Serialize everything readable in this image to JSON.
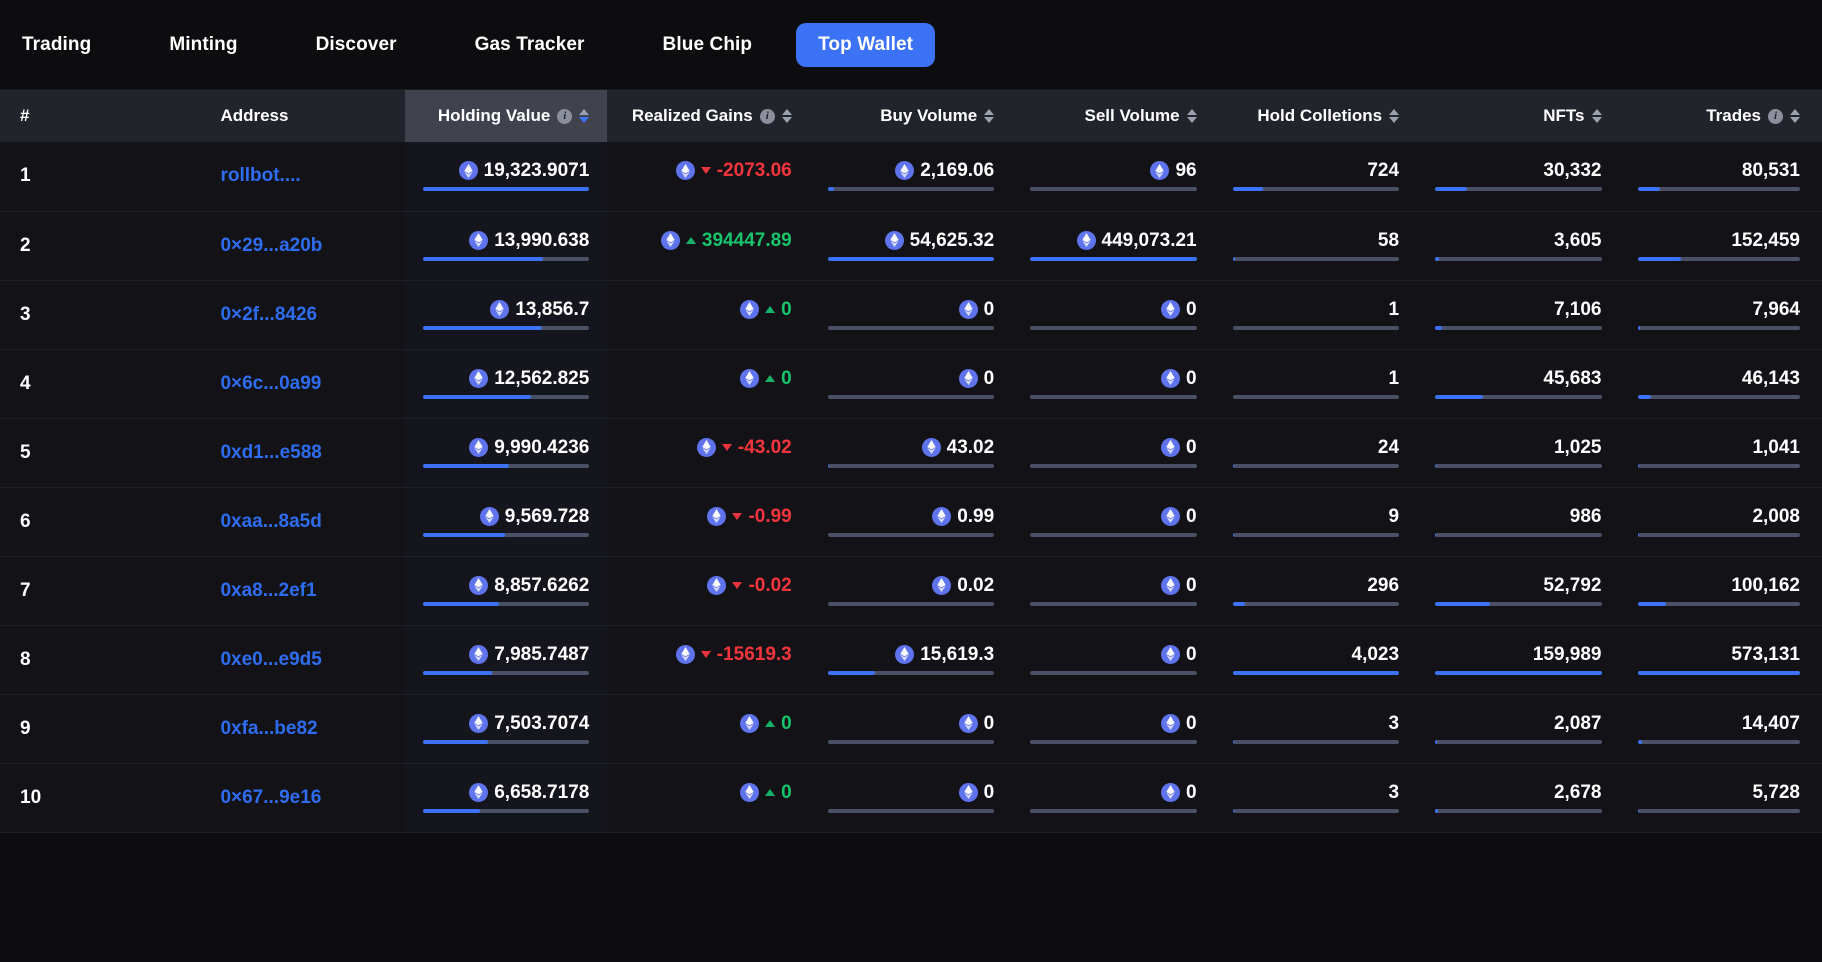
{
  "nav": {
    "items": [
      {
        "label": "Trading",
        "active": false
      },
      {
        "label": "Minting",
        "active": false
      },
      {
        "label": "Discover",
        "active": false
      },
      {
        "label": "Gas Tracker",
        "active": false
      },
      {
        "label": "Blue Chip",
        "active": false
      },
      {
        "label": "Top Wallet",
        "active": true
      }
    ]
  },
  "colors": {
    "accent": "#3b72f6",
    "link": "#2f6df0",
    "positive": "#18c46c",
    "negative": "#f4353d",
    "bar_track": "#4a5166",
    "header_bg": "#22242c",
    "header_active_bg": "#40434e",
    "page_bg": "#0d0d10",
    "table_bg": "#121217"
  },
  "table": {
    "columns": [
      {
        "key": "rank",
        "label": "#",
        "align": "left",
        "info": false,
        "sortable": false,
        "sort": "none",
        "active": false
      },
      {
        "key": "address",
        "label": "Address",
        "align": "left",
        "info": false,
        "sortable": false,
        "sort": "none",
        "active": false
      },
      {
        "key": "holding",
        "label": "Holding Value",
        "align": "right",
        "info": true,
        "sortable": true,
        "sort": "desc",
        "active": true
      },
      {
        "key": "gains",
        "label": "Realized Gains",
        "align": "right",
        "info": true,
        "sortable": true,
        "sort": "none",
        "active": false
      },
      {
        "key": "buy",
        "label": "Buy Volume",
        "align": "right",
        "info": false,
        "sortable": true,
        "sort": "none",
        "active": false
      },
      {
        "key": "sell",
        "label": "Sell Volume",
        "align": "right",
        "info": false,
        "sortable": true,
        "sort": "none",
        "active": false
      },
      {
        "key": "hold",
        "label": "Hold Colletions",
        "align": "right",
        "info": false,
        "sortable": true,
        "sort": "none",
        "active": false
      },
      {
        "key": "nfts",
        "label": "NFTs",
        "align": "right",
        "info": false,
        "sortable": true,
        "sort": "none",
        "active": false
      },
      {
        "key": "trades",
        "label": "Trades",
        "align": "right",
        "info": true,
        "sortable": true,
        "sort": "none",
        "active": false
      }
    ],
    "maxima": {
      "holding": 19323.9071,
      "buy": 54625.32,
      "sell": 449073.21,
      "hold": 4023,
      "nfts": 159989,
      "trades": 573131
    },
    "rows": [
      {
        "rank": "1",
        "address": "rollbot....",
        "holding": {
          "text": "19,323.9071",
          "value": 19323.9071,
          "eth": true
        },
        "gains": {
          "text": "-2073.06",
          "value": -2073.06,
          "eth": true,
          "dir": "down"
        },
        "buy": {
          "text": "2,169.06",
          "value": 2169.06,
          "eth": true
        },
        "sell": {
          "text": "96",
          "value": 96,
          "eth": true
        },
        "hold": {
          "text": "724",
          "value": 724,
          "eth": false
        },
        "nfts": {
          "text": "30,332",
          "value": 30332,
          "eth": false
        },
        "trades": {
          "text": "80,531",
          "value": 80531,
          "eth": false
        }
      },
      {
        "rank": "2",
        "address": "0×29...a20b",
        "holding": {
          "text": "13,990.638",
          "value": 13990.638,
          "eth": true
        },
        "gains": {
          "text": "394447.89",
          "value": 394447.89,
          "eth": true,
          "dir": "up"
        },
        "buy": {
          "text": "54,625.32",
          "value": 54625.32,
          "eth": true
        },
        "sell": {
          "text": "449,073.21",
          "value": 449073.21,
          "eth": true
        },
        "hold": {
          "text": "58",
          "value": 58,
          "eth": false
        },
        "nfts": {
          "text": "3,605",
          "value": 3605,
          "eth": false
        },
        "trades": {
          "text": "152,459",
          "value": 152459,
          "eth": false
        }
      },
      {
        "rank": "3",
        "address": "0×2f...8426",
        "holding": {
          "text": "13,856.7",
          "value": 13856.7,
          "eth": true
        },
        "gains": {
          "text": "0",
          "value": 0,
          "eth": true,
          "dir": "up"
        },
        "buy": {
          "text": "0",
          "value": 0,
          "eth": true
        },
        "sell": {
          "text": "0",
          "value": 0,
          "eth": true
        },
        "hold": {
          "text": "1",
          "value": 1,
          "eth": false
        },
        "nfts": {
          "text": "7,106",
          "value": 7106,
          "eth": false
        },
        "trades": {
          "text": "7,964",
          "value": 7964,
          "eth": false
        }
      },
      {
        "rank": "4",
        "address": "0×6c...0a99",
        "holding": {
          "text": "12,562.825",
          "value": 12562.825,
          "eth": true
        },
        "gains": {
          "text": "0",
          "value": 0,
          "eth": true,
          "dir": "up"
        },
        "buy": {
          "text": "0",
          "value": 0,
          "eth": true
        },
        "sell": {
          "text": "0",
          "value": 0,
          "eth": true
        },
        "hold": {
          "text": "1",
          "value": 1,
          "eth": false
        },
        "nfts": {
          "text": "45,683",
          "value": 45683,
          "eth": false
        },
        "trades": {
          "text": "46,143",
          "value": 46143,
          "eth": false
        }
      },
      {
        "rank": "5",
        "address": "0xd1...e588",
        "holding": {
          "text": "9,990.4236",
          "value": 9990.4236,
          "eth": true
        },
        "gains": {
          "text": "-43.02",
          "value": -43.02,
          "eth": true,
          "dir": "down"
        },
        "buy": {
          "text": "43.02",
          "value": 43.02,
          "eth": true
        },
        "sell": {
          "text": "0",
          "value": 0,
          "eth": true
        },
        "hold": {
          "text": "24",
          "value": 24,
          "eth": false
        },
        "nfts": {
          "text": "1,025",
          "value": 1025,
          "eth": false
        },
        "trades": {
          "text": "1,041",
          "value": 1041,
          "eth": false
        }
      },
      {
        "rank": "6",
        "address": "0xaa...8a5d",
        "holding": {
          "text": "9,569.728",
          "value": 9569.728,
          "eth": true
        },
        "gains": {
          "text": "-0.99",
          "value": -0.99,
          "eth": true,
          "dir": "down"
        },
        "buy": {
          "text": "0.99",
          "value": 0.99,
          "eth": true
        },
        "sell": {
          "text": "0",
          "value": 0,
          "eth": true
        },
        "hold": {
          "text": "9",
          "value": 9,
          "eth": false
        },
        "nfts": {
          "text": "986",
          "value": 986,
          "eth": false
        },
        "trades": {
          "text": "2,008",
          "value": 2008,
          "eth": false
        }
      },
      {
        "rank": "7",
        "address": "0xa8...2ef1",
        "holding": {
          "text": "8,857.6262",
          "value": 8857.6262,
          "eth": true
        },
        "gains": {
          "text": "-0.02",
          "value": -0.02,
          "eth": true,
          "dir": "down"
        },
        "buy": {
          "text": "0.02",
          "value": 0.02,
          "eth": true
        },
        "sell": {
          "text": "0",
          "value": 0,
          "eth": true
        },
        "hold": {
          "text": "296",
          "value": 296,
          "eth": false
        },
        "nfts": {
          "text": "52,792",
          "value": 52792,
          "eth": false
        },
        "trades": {
          "text": "100,162",
          "value": 100162,
          "eth": false
        }
      },
      {
        "rank": "8",
        "address": "0xe0...e9d5",
        "holding": {
          "text": "7,985.7487",
          "value": 7985.7487,
          "eth": true
        },
        "gains": {
          "text": "-15619.3",
          "value": -15619.3,
          "eth": true,
          "dir": "down"
        },
        "buy": {
          "text": "15,619.3",
          "value": 15619.3,
          "eth": true
        },
        "sell": {
          "text": "0",
          "value": 0,
          "eth": true
        },
        "hold": {
          "text": "4,023",
          "value": 4023,
          "eth": false
        },
        "nfts": {
          "text": "159,989",
          "value": 159989,
          "eth": false
        },
        "trades": {
          "text": "573,131",
          "value": 573131,
          "eth": false
        }
      },
      {
        "rank": "9",
        "address": "0xfa...be82",
        "holding": {
          "text": "7,503.7074",
          "value": 7503.7074,
          "eth": true
        },
        "gains": {
          "text": "0",
          "value": 0,
          "eth": true,
          "dir": "up"
        },
        "buy": {
          "text": "0",
          "value": 0,
          "eth": true
        },
        "sell": {
          "text": "0",
          "value": 0,
          "eth": true
        },
        "hold": {
          "text": "3",
          "value": 3,
          "eth": false
        },
        "nfts": {
          "text": "2,087",
          "value": 2087,
          "eth": false
        },
        "trades": {
          "text": "14,407",
          "value": 14407,
          "eth": false
        }
      },
      {
        "rank": "10",
        "address": "0×67...9e16",
        "holding": {
          "text": "6,658.7178",
          "value": 6658.7178,
          "eth": true
        },
        "gains": {
          "text": "0",
          "value": 0,
          "eth": true,
          "dir": "up"
        },
        "buy": {
          "text": "0",
          "value": 0,
          "eth": true
        },
        "sell": {
          "text": "0",
          "value": 0,
          "eth": true
        },
        "hold": {
          "text": "3",
          "value": 3,
          "eth": false
        },
        "nfts": {
          "text": "2,678",
          "value": 2678,
          "eth": false
        },
        "trades": {
          "text": "5,728",
          "value": 5728,
          "eth": false
        }
      }
    ]
  }
}
